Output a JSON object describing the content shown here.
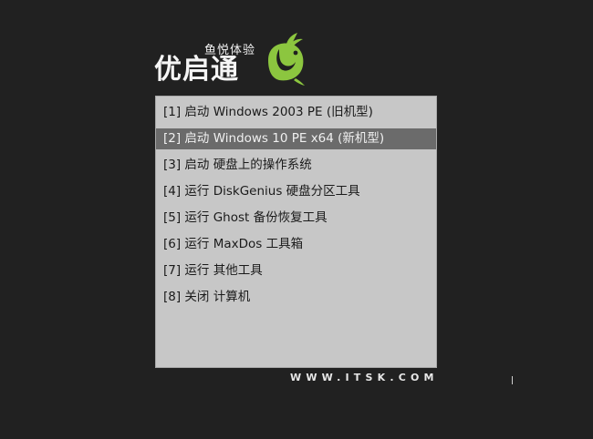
{
  "logo": {
    "subtitle": "鱼悦体验",
    "title": "优启通",
    "fish_color": "#8cc63f"
  },
  "menu": {
    "selected_index": 1,
    "items": [
      {
        "label": "[1] 启动 Windows 2003 PE (旧机型)"
      },
      {
        "label": "[2] 启动 Windows 10 PE x64 (新机型)"
      },
      {
        "label": "[3] 启动 硬盘上的操作系统"
      },
      {
        "label": "[4] 运行 DiskGenius 硬盘分区工具"
      },
      {
        "label": "[5] 运行 Ghost 备份恢复工具"
      },
      {
        "label": "[6] 运行 MaxDos 工具箱"
      },
      {
        "label": "[7] 运行 其他工具"
      },
      {
        "label": "[8] 关闭 计算机"
      }
    ]
  },
  "footer": {
    "url": "WWW.ITSK.COM"
  },
  "colors": {
    "background": "#212121",
    "panel": "#c7c7c7",
    "selection": "#6b6b6b"
  }
}
